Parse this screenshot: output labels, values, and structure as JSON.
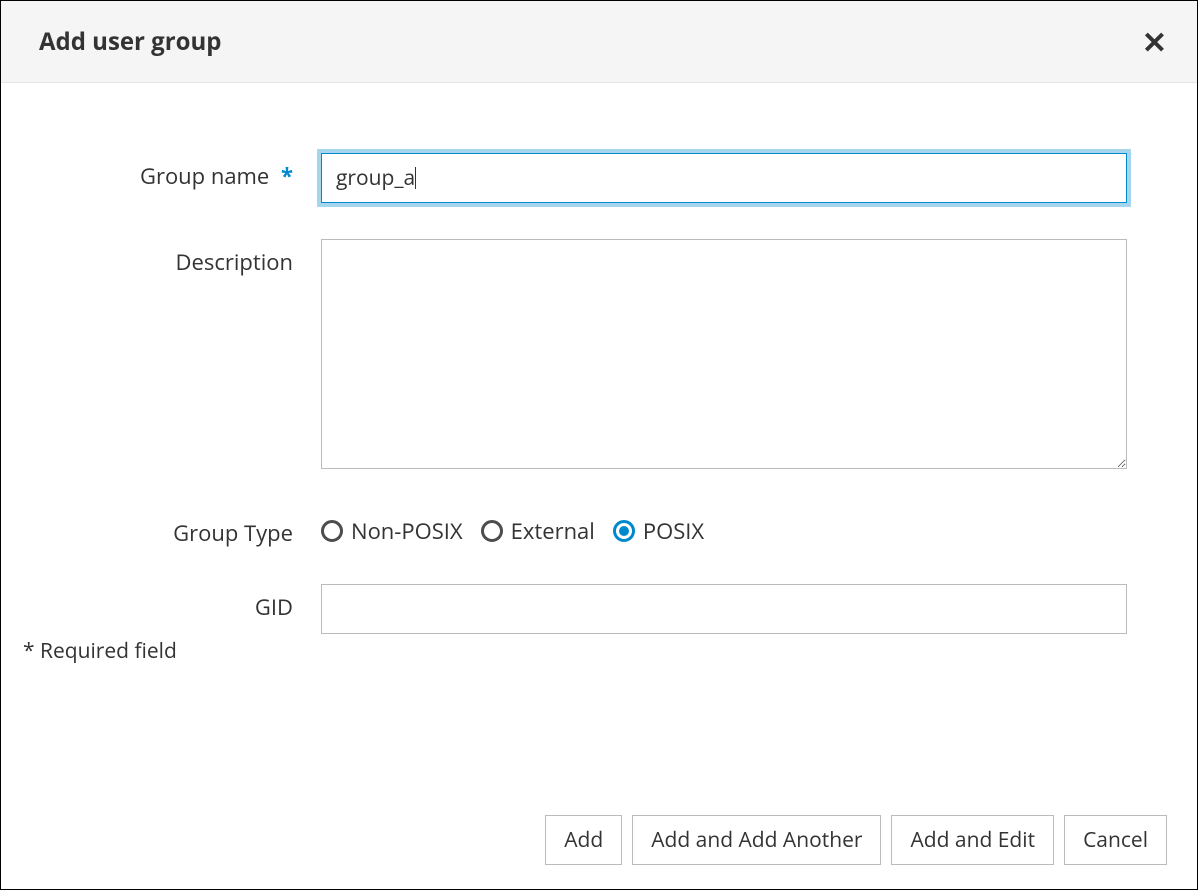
{
  "dialog": {
    "title": "Add user group"
  },
  "form": {
    "groupName": {
      "label": "Group name",
      "value": "group_a",
      "required": true
    },
    "description": {
      "label": "Description",
      "value": ""
    },
    "groupType": {
      "label": "Group Type",
      "options": [
        {
          "label": "Non-POSIX",
          "selected": false
        },
        {
          "label": "External",
          "selected": false
        },
        {
          "label": "POSIX",
          "selected": true
        }
      ]
    },
    "gid": {
      "label": "GID",
      "value": ""
    },
    "requiredNote": "* Required field"
  },
  "buttons": {
    "add": "Add",
    "addAnother": "Add and Add Another",
    "addEdit": "Add and Edit",
    "cancel": "Cancel"
  }
}
